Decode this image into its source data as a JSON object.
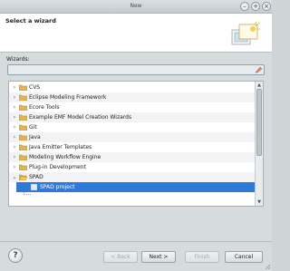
{
  "window": {
    "title": "New"
  },
  "header": {
    "title": "Select a wizard"
  },
  "filter": {
    "label": "Wizards:",
    "value": "",
    "placeholder": ""
  },
  "tree": {
    "items": [
      {
        "label": "CVS",
        "expanded": false
      },
      {
        "label": "Eclipse Modeling Framework",
        "expanded": false
      },
      {
        "label": "Ecore Tools",
        "expanded": false
      },
      {
        "label": "Example EMF Model Creation Wizards",
        "expanded": false
      },
      {
        "label": "Git",
        "expanded": false
      },
      {
        "label": "Java",
        "expanded": false
      },
      {
        "label": "Java Emitter Templates",
        "expanded": false
      },
      {
        "label": "Modeling Workflow Engine",
        "expanded": false
      },
      {
        "label": "Plug-in Development",
        "expanded": false
      },
      {
        "label": "SPAD",
        "expanded": true
      },
      {
        "label": "SPAD project",
        "selected": true
      }
    ]
  },
  "buttons": {
    "help": "?",
    "back": "< Back",
    "next": "Next >",
    "finish": "Finish",
    "cancel": "Cancel"
  },
  "colors": {
    "selection": "#2f7ad8",
    "folder": "#e2b451"
  }
}
